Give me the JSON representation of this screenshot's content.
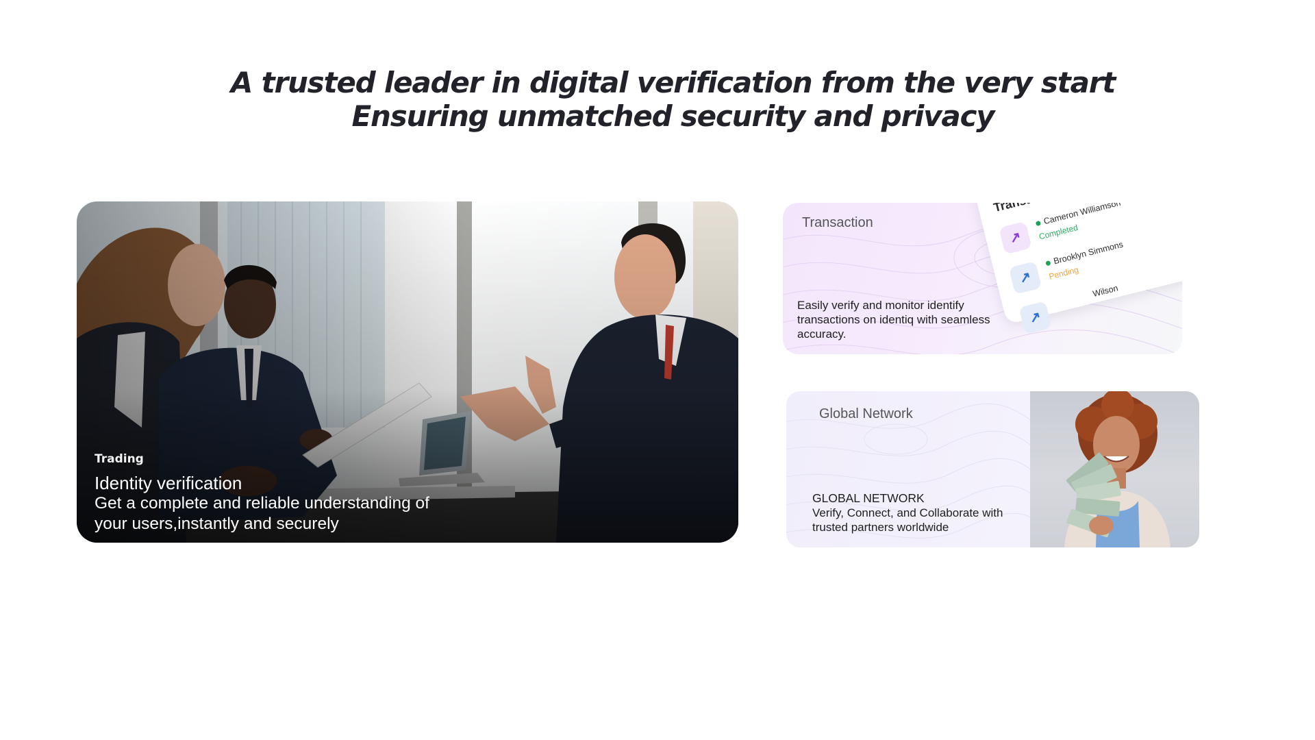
{
  "headline": {
    "line1": "A trusted leader in digital verification from the very start",
    "line2": "Ensuring unmatched security and privacy"
  },
  "hero": {
    "tag": "Trading",
    "title": "Identity verification",
    "description": "Get a complete and reliable understanding of your users,instantly and securely"
  },
  "transaction_card": {
    "label": "Transaction",
    "description": "Easily verify and monitor identify transactions on identiq with seamless accuracy.",
    "panel": {
      "title": "Transactions",
      "rows": [
        {
          "name": "Cameron Williamson",
          "status": "Completed",
          "status_color": "#2fae63",
          "icon_color": "#8b3fd6",
          "icon_bg": "#f1e4fb"
        },
        {
          "name": "Brooklyn Simmons",
          "status": "Pending",
          "status_color": "#f1a33a",
          "icon_color": "#2e6fd3",
          "icon_bg": "#e3ecf8"
        },
        {
          "name": "Wilson",
          "status": "",
          "status_color": "#2fae63",
          "icon_color": "#2e6fd3",
          "icon_bg": "#e3ecf8"
        }
      ]
    }
  },
  "network_card": {
    "label": "Global Network",
    "heading": "GLOBAL NETWORK",
    "description": "Verify, Connect, and Collaborate with trusted partners worldwide"
  }
}
